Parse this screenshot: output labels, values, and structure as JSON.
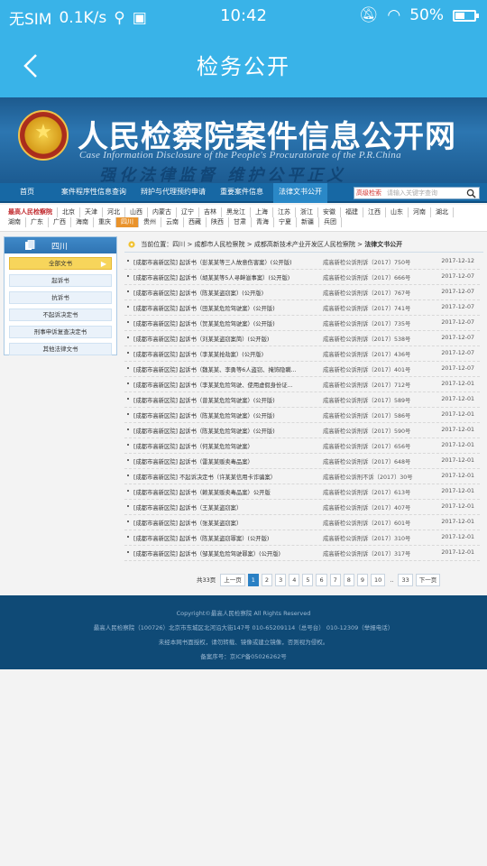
{
  "status_bar": {
    "carrier": "无SIM",
    "speed": "0.1K/s",
    "time": "10:42",
    "battery_text": "50%",
    "battery_level": 0.5
  },
  "app_bar": {
    "title": "检务公开"
  },
  "banner": {
    "title": "人民检察院案件信息公开网",
    "en_title": "Case Information Disclosure of the People's Procuratorate of the P.R.China",
    "slogan": "强化法律监督 维护公平正义"
  },
  "nav": {
    "items": [
      "首页",
      "案件程序性信息查询",
      "辩护与代理预约申请",
      "重要案件信息",
      "法律文书公开"
    ],
    "search_select": "高级检索",
    "search_placeholder": "请输入关键字查询"
  },
  "provinces": {
    "first": "最高人民检察院",
    "row1": [
      "北京",
      "天津",
      "河北",
      "山西",
      "内蒙古",
      "辽宁",
      "吉林",
      "黑龙江",
      "上海",
      "江苏",
      "浙江",
      "安徽",
      "福建",
      "江西",
      "山东",
      "河南",
      "湖北"
    ],
    "row2": [
      "湖南",
      "广东",
      "广西",
      "海南",
      "重庆",
      "四川",
      "贵州",
      "云南",
      "西藏",
      "陕西",
      "甘肃",
      "青海",
      "宁夏",
      "新疆",
      "兵团"
    ]
  },
  "left_panel": {
    "header": "四川",
    "items": [
      "全部文书",
      "起诉书",
      "抗诉书",
      "不起诉决定书",
      "刑事申诉复查决定书",
      "其他法律文书"
    ]
  },
  "breadcrumb": {
    "prefix": "当前位置：",
    "path": "四川 > 成都市人民检察院 > 成都高新技术产业开发区人民检察院 > ",
    "current": "法律文书公开"
  },
  "documents": [
    {
      "title": "[成都市高新区院] 起诉书（彭某某等三人故意伤害案）(公开版)",
      "number": "成高新检公诉刑诉〔2017〕750号",
      "date": "2017-12-12"
    },
    {
      "title": "[成都市高新区院] 起诉书（胡某某等5人寻衅滋事案）(公开版)",
      "number": "成高新检公诉刑诉〔2017〕666号",
      "date": "2017-12-07"
    },
    {
      "title": "[成都市高新区院] 起诉书（陈某某盗窃案）(公开版)",
      "number": "成高新检公诉刑诉〔2017〕767号",
      "date": "2017-12-07"
    },
    {
      "title": "[成都市高新区院] 起诉书（田某某危险驾驶案）(公开版)",
      "number": "成高新检公诉刑诉〔2017〕741号",
      "date": "2017-12-07"
    },
    {
      "title": "[成都市高新区院] 起诉书（贺某某危险驾驶案）(公开版)",
      "number": "成高新检公诉刑诉〔2017〕735号",
      "date": "2017-12-07"
    },
    {
      "title": "[成都市高新区院] 起诉书（刘某某盗窃案简）(公开版)",
      "number": "成高新检公诉刑诉〔2017〕538号",
      "date": "2017-12-07"
    },
    {
      "title": "[成都市高新区院] 起诉书（李某某抢劫案）(公开版)",
      "number": "成高新检公诉刑诉〔2017〕436号",
      "date": "2017-12-07"
    },
    {
      "title": "[成都市高新区院] 起诉书（魏某某、李勇等6人盗窃、掩饰隐瞒...",
      "number": "成高新检公诉刑诉〔2017〕401号",
      "date": "2017-12-07"
    },
    {
      "title": "[成都市高新区院] 起诉书（李某某危险驾驶、使用虚假身份证...",
      "number": "成高新检公诉刑诉〔2017〕712号",
      "date": "2017-12-01"
    },
    {
      "title": "[成都市高新区院] 起诉书（曾某某危险驾驶案）(公开版)",
      "number": "成高新检公诉刑诉〔2017〕589号",
      "date": "2017-12-01"
    },
    {
      "title": "[成都市高新区院] 起诉书（陈某某危险驾驶案）(公开版)",
      "number": "成高新检公诉刑诉〔2017〕586号",
      "date": "2017-12-01"
    },
    {
      "title": "[成都市高新区院] 起诉书（陈某某危险驾驶案）(公开版)",
      "number": "成高新检公诉刑诉〔2017〕590号",
      "date": "2017-12-01"
    },
    {
      "title": "[成都市高新区院] 起诉书（何某某危险驾驶案）",
      "number": "成高新检公诉刑诉〔2017〕656号",
      "date": "2017-12-01"
    },
    {
      "title": "[成都市高新区院] 起诉书（雷某某贩卖毒品案）",
      "number": "成高新检公诉刑诉〔2017〕648号",
      "date": "2017-12-01"
    },
    {
      "title": "[成都市高新区院] 不起诉决定书（许某某信用卡诈骗案）",
      "number": "成高新检公诉刑不诉〔2017〕30号",
      "date": "2017-12-01"
    },
    {
      "title": "[成都市高新区院] 起诉书（赖某某贩卖毒品案）公开版",
      "number": "成高新检公诉刑诉〔2017〕613号",
      "date": "2017-12-01"
    },
    {
      "title": "[成都市高新区院] 起诉书（王某某盗窃案）",
      "number": "成高新检公诉刑诉〔2017〕407号",
      "date": "2017-12-01"
    },
    {
      "title": "[成都市高新区院] 起诉书（张某某盗窃案）",
      "number": "成高新检公诉刑诉〔2017〕601号",
      "date": "2017-12-01"
    },
    {
      "title": "[成都市高新区院] 起诉书（陈某某盗窃罪案）(公开版)",
      "number": "成高新检公诉刑诉〔2017〕310号",
      "date": "2017-12-01"
    },
    {
      "title": "[成都市高新区院] 起诉书（邹某某危险驾驶罪案）(公开版)",
      "number": "成高新检公诉刑诉〔2017〕317号",
      "date": "2017-12-01"
    }
  ],
  "pager": {
    "total": "共33页",
    "prev": "上一页",
    "pages": [
      "1",
      "2",
      "3",
      "4",
      "5",
      "6",
      "7",
      "8",
      "9",
      "10"
    ],
    "ellipsis": "..",
    "last": "33",
    "next": "下一页"
  },
  "footer": {
    "copyright": "Copyright©最高人民检察院 All Rights Reserved",
    "address": "最高人民检察院（100726）北京市东城区北河沿大街147号 010-65209114（总号台） 010-12309（举报电话）",
    "notice": "未经本网书面授权，请勿转载、镜像或建立镜像，否则视为侵权。",
    "icp": "备案序号：京ICP备05026262号"
  }
}
